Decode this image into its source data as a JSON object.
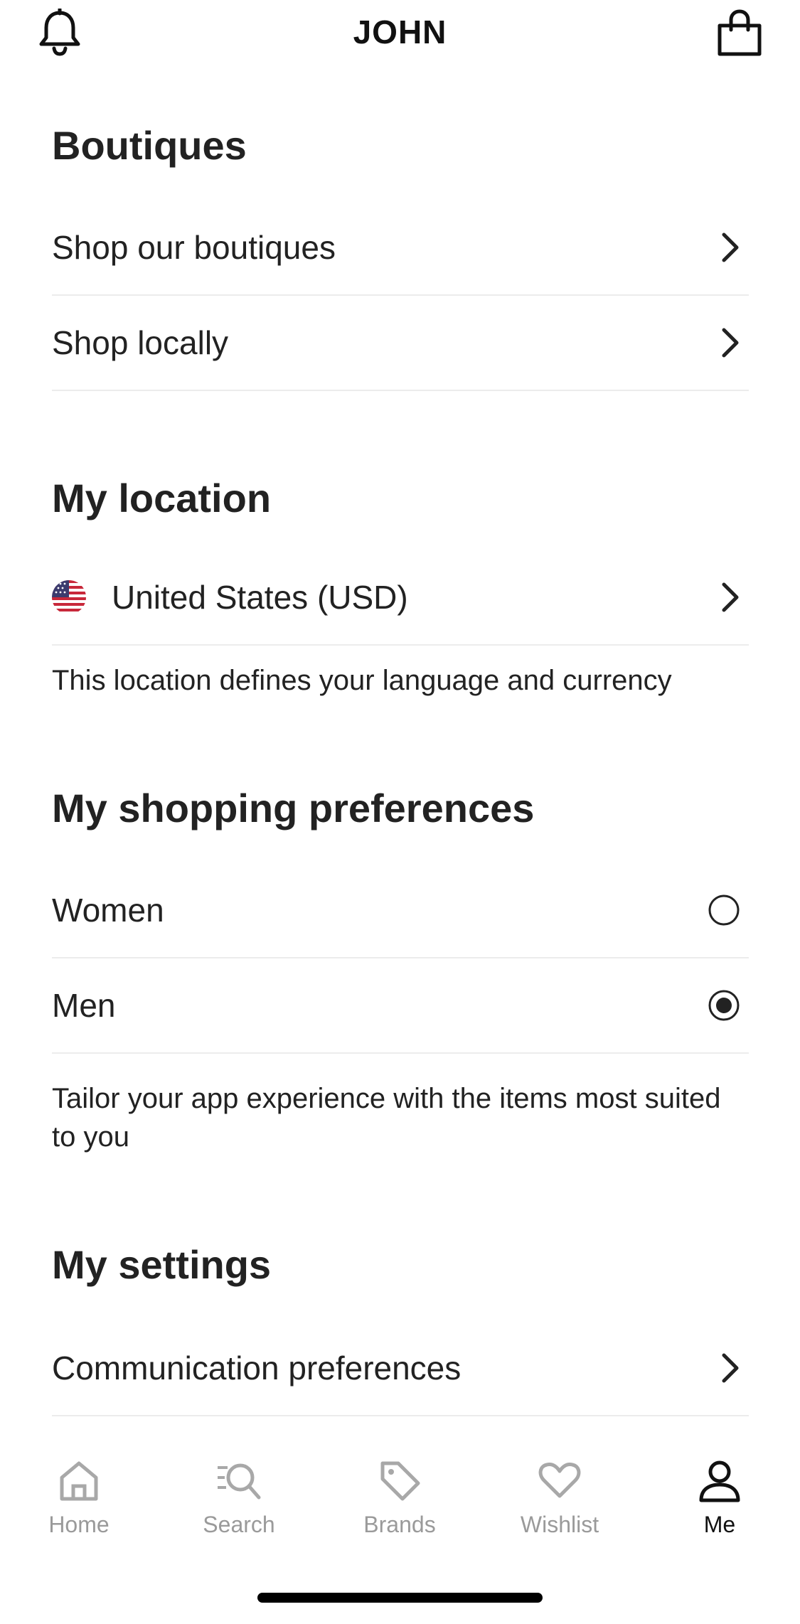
{
  "header": {
    "title": "JOHN",
    "left_icon": "bell-icon",
    "right_icon": "shopping-bag-icon"
  },
  "boutiques": {
    "title": "Boutiques",
    "items": [
      {
        "label": "Shop our boutiques",
        "icon": "chevron-right-icon"
      },
      {
        "label": "Shop locally",
        "icon": "chevron-right-icon"
      }
    ]
  },
  "location": {
    "title": "My location",
    "selected": {
      "label": "United States (USD)",
      "icon": "us-flag-icon"
    },
    "helper": "This location defines your language and currency"
  },
  "preferences": {
    "title": "My shopping preferences",
    "options": [
      {
        "label": "Women",
        "selected": false
      },
      {
        "label": "Men",
        "selected": true
      }
    ],
    "helper": "Tailor your app experience with the items most suited to you"
  },
  "settings": {
    "title": "My settings",
    "items": [
      {
        "label": "Communication preferences",
        "icon": "chevron-right-icon"
      }
    ]
  },
  "bottom_nav": {
    "active": "Me",
    "items": [
      {
        "label": "Home",
        "icon": "home-icon"
      },
      {
        "label": "Search",
        "icon": "search-icon"
      },
      {
        "label": "Brands",
        "icon": "tag-icon"
      },
      {
        "label": "Wishlist",
        "icon": "heart-icon"
      },
      {
        "label": "Me",
        "icon": "user-icon"
      }
    ]
  },
  "colors": {
    "text": "#222222",
    "divider": "#ececec",
    "inactive_nav": "#9a9a9a",
    "active_nav": "#111111"
  }
}
